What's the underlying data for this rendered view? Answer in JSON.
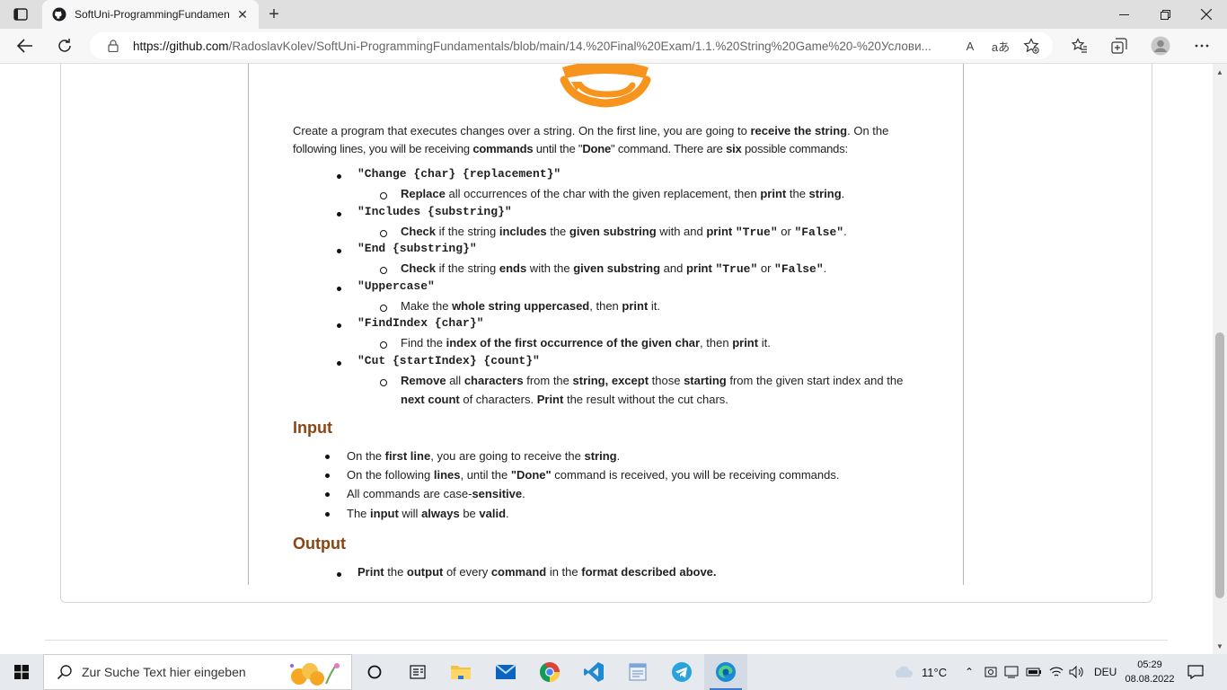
{
  "browser": {
    "tab_title": "SoftUni-ProgrammingFundamen",
    "url_domain": "https://github.com",
    "url_path": "/RadoslavKolev/SoftUni-ProgrammingFundamentals/blob/main/14.%20Final%20Exam/1.1.%20String%20Game%20-%20Услови...",
    "read_aloud": "A",
    "translate": "aあ"
  },
  "doc": {
    "intro_1": "Create a program that executes changes over a string. On the first line, you are going to ",
    "intro_1b": "receive the string",
    "intro_1c": ". On the",
    "intro_2a": "following lines, you will be receiving ",
    "intro_2b": "commands",
    "intro_2c": " until the \"",
    "intro_2d": "Done",
    "intro_2e": "\" command. There are ",
    "intro_2f": "six",
    "intro_2g": " possible commands:",
    "commands": [
      {
        "cmd": "\"Change {char} {replacement}\"",
        "desc": [
          {
            "t": "Replace",
            "b": true
          },
          {
            "t": " all occurrences of the char with the given replacement, then ",
            "b": false
          },
          {
            "t": "print",
            "b": true
          },
          {
            "t": " the ",
            "b": false
          },
          {
            "t": "string",
            "b": true
          },
          {
            "t": ".",
            "b": false
          }
        ]
      },
      {
        "cmd": "\"Includes {substring}\"",
        "desc": [
          {
            "t": "Check",
            "b": true
          },
          {
            "t": " if the string ",
            "b": false
          },
          {
            "t": "includes",
            "b": true
          },
          {
            "t": " the ",
            "b": false
          },
          {
            "t": "given substring",
            "b": true
          },
          {
            "t": " with and ",
            "b": false
          },
          {
            "t": "print ",
            "b": true
          },
          {
            "t": "\"True\"",
            "b": true,
            "m": true
          },
          {
            "t": " or ",
            "b": false
          },
          {
            "t": "\"False\"",
            "b": true,
            "m": true
          },
          {
            "t": ".",
            "b": false
          }
        ]
      },
      {
        "cmd": "\"End {substring}\"",
        "desc": [
          {
            "t": "Check",
            "b": true
          },
          {
            "t": " if the string ",
            "b": false
          },
          {
            "t": "ends",
            "b": true
          },
          {
            "t": " with the ",
            "b": false
          },
          {
            "t": "given substring",
            "b": true
          },
          {
            "t": " and ",
            "b": false
          },
          {
            "t": "print ",
            "b": true
          },
          {
            "t": "\"True\"",
            "b": true,
            "m": true
          },
          {
            "t": " or ",
            "b": false
          },
          {
            "t": "\"False\"",
            "b": true,
            "m": true
          },
          {
            "t": ".",
            "b": false
          }
        ]
      },
      {
        "cmd": "\"Uppercase\"",
        "desc": [
          {
            "t": "Make the ",
            "b": false
          },
          {
            "t": "whole string uppercased",
            "b": true
          },
          {
            "t": ", then ",
            "b": false
          },
          {
            "t": "print",
            "b": true
          },
          {
            "t": " it.",
            "b": false
          }
        ]
      },
      {
        "cmd": "\"FindIndex {char}\"",
        "desc": [
          {
            "t": "Find the ",
            "b": false
          },
          {
            "t": "index of the first occurrence of the given char",
            "b": true
          },
          {
            "t": ",  then ",
            "b": false
          },
          {
            "t": "print",
            "b": true
          },
          {
            "t": " it.",
            "b": false
          }
        ]
      },
      {
        "cmd": "\"Cut {startIndex} {count}\"",
        "desc": [
          {
            "t": "Remove",
            "b": true
          },
          {
            "t": " all ",
            "b": false
          },
          {
            "t": "characters",
            "b": true
          },
          {
            "t": "  from the ",
            "b": false
          },
          {
            "t": "string, except",
            "b": true
          },
          {
            "t": " those ",
            "b": false
          },
          {
            "t": "starting",
            "b": true
          },
          {
            "t": "  from the given start index and the",
            "b": false
          }
        ],
        "desc2": [
          {
            "t": "next count",
            "b": true
          },
          {
            "t": "  of characters. ",
            "b": false
          },
          {
            "t": "Print",
            "b": true
          },
          {
            "t": " the result without the cut chars.",
            "b": false
          }
        ]
      }
    ],
    "input_heading": "Input",
    "input_lines": [
      [
        {
          "t": "On the ",
          "b": false
        },
        {
          "t": "first line",
          "b": true
        },
        {
          "t": ", you are going to receive the ",
          "b": false
        },
        {
          "t": "string",
          "b": true
        },
        {
          "t": ".",
          "b": false
        }
      ],
      [
        {
          "t": "On the following ",
          "b": false
        },
        {
          "t": "lines",
          "b": true
        },
        {
          "t": ", until the ",
          "b": false
        },
        {
          "t": "\"Done\"",
          "b": true
        },
        {
          "t": " command is received, you will be receiving commands.",
          "b": false
        }
      ],
      [
        {
          "t": "All commands are case-",
          "b": false
        },
        {
          "t": "sensitive",
          "b": true
        },
        {
          "t": ".",
          "b": false
        }
      ],
      [
        {
          "t": "The ",
          "b": false
        },
        {
          "t": "input",
          "b": true
        },
        {
          "t": " will ",
          "b": false
        },
        {
          "t": "always",
          "b": true
        },
        {
          "t": " be ",
          "b": false
        },
        {
          "t": "valid",
          "b": true
        },
        {
          "t": ".",
          "b": false
        }
      ]
    ],
    "output_heading": "Output",
    "output_lines": [
      [
        {
          "t": "Print",
          "b": true
        },
        {
          "t": " the ",
          "b": false
        },
        {
          "t": "output",
          "b": true
        },
        {
          "t": " of every ",
          "b": false
        },
        {
          "t": "command",
          "b": true
        },
        {
          "t": " in  the ",
          "b": false
        },
        {
          "t": "format described above.",
          "b": true
        }
      ]
    ]
  },
  "taskbar": {
    "search_placeholder": "Zur Suche Text hier eingeben",
    "weather": "11°C",
    "language": "DEU",
    "time": "05:29",
    "date": "08.08.2022"
  },
  "colors": {
    "heading": "#8b4513",
    "logo": "#f7941d",
    "accent": "#3b78d0"
  }
}
